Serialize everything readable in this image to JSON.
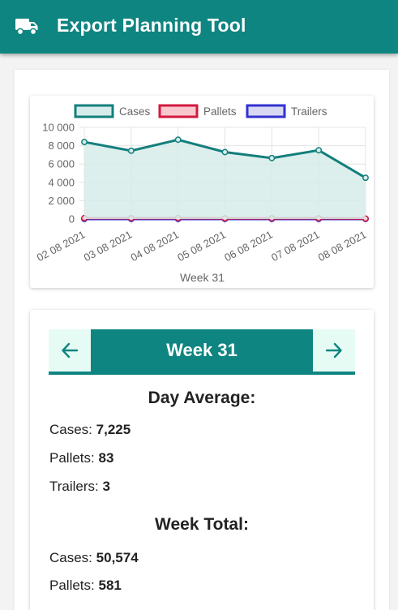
{
  "app": {
    "title": "Export Planning Tool",
    "icon": "truck-icon"
  },
  "chart_data": {
    "type": "line",
    "xlabel": "Week 31",
    "categories": [
      "02 08 2021",
      "03 08 2021",
      "04 08 2021",
      "05 08 2021",
      "06 08 2021",
      "07 08 2021",
      "08 08 2021"
    ],
    "ylim": [
      0,
      10000
    ],
    "yticks": [
      "10 000",
      "8 000",
      "6 000",
      "4 000",
      "2 000",
      "0"
    ],
    "ytick_values": [
      10000,
      8000,
      6000,
      4000,
      2000,
      0
    ],
    "legend_position": "top",
    "grid": true,
    "series": [
      {
        "name": "Cases",
        "values": [
          8400,
          7450,
          8650,
          7300,
          6650,
          7500,
          4500
        ],
        "color": "#137f7c",
        "fill": "#d6ecea"
      },
      {
        "name": "Pallets",
        "values": [
          100,
          90,
          100,
          80,
          80,
          85,
          50
        ],
        "color": "#d3183f",
        "fill": "#f9c8cf"
      },
      {
        "name": "Trailers",
        "values": [
          3,
          3,
          3,
          3,
          3,
          3,
          2
        ],
        "color": "#3131d1",
        "fill": "#d8d8f3"
      }
    ]
  },
  "week_nav": {
    "prev_icon": "arrow-left-icon",
    "next_icon": "arrow-right-icon",
    "label": "Week 31"
  },
  "day_average": {
    "heading": "Day Average:",
    "cases_label": "Cases:",
    "cases_value": "7,225",
    "pallets_label": "Pallets:",
    "pallets_value": "83",
    "trailers_label": "Trailers:",
    "trailers_value": "3"
  },
  "week_total": {
    "heading": "Week Total:",
    "cases_label": "Cases:",
    "cases_value": "50,574",
    "pallets_label": "Pallets:",
    "pallets_value": "581"
  },
  "colors": {
    "brand": "#0f8581",
    "nav_button_bg": "#e6fbf4"
  }
}
